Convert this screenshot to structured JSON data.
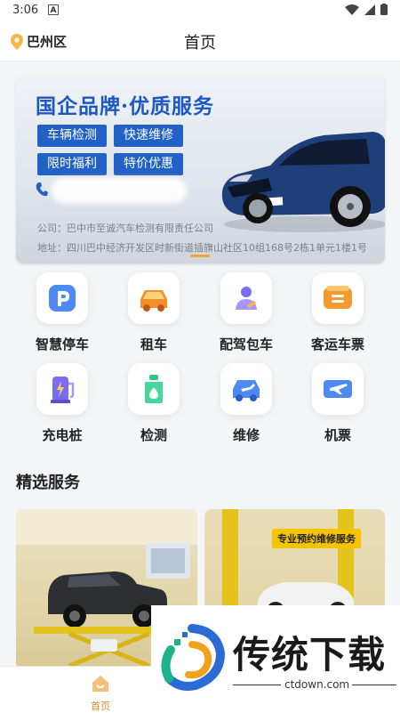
{
  "status": {
    "time": "3:06",
    "notif": "A"
  },
  "header": {
    "location": "巴州区",
    "title": "首页"
  },
  "banner": {
    "title": "国企品牌·优质服务",
    "tags": [
      "车辆检测",
      "快速维修",
      "限时福利",
      "特价优惠"
    ],
    "company": "公司：巴中市至诚汽车检测有限责任公司",
    "address": "地址：四川巴中经济开发区时新街道插旗山社区10组168号2栋1单元1楼1号"
  },
  "services": [
    {
      "label": "智慧停车",
      "icon": "parking-icon"
    },
    {
      "label": "租车",
      "icon": "car-rental-icon"
    },
    {
      "label": "配驾包车",
      "icon": "driver-icon"
    },
    {
      "label": "客运车票",
      "icon": "bus-ticket-icon"
    },
    {
      "label": "充电桩",
      "icon": "charging-icon"
    },
    {
      "label": "检测",
      "icon": "inspection-icon"
    },
    {
      "label": "维修",
      "icon": "repair-icon"
    },
    {
      "label": "机票",
      "icon": "flight-ticket-icon"
    }
  ],
  "section": {
    "title": "精选服务"
  },
  "cards": [
    {
      "image": "suv-on-lift"
    },
    {
      "banner_text": "专业预约维修服务"
    }
  ],
  "nav": {
    "home_label": "首页"
  },
  "watermark": {
    "text": "传统下载",
    "url": "ctdown.com"
  },
  "colors": {
    "accent": "#e58a1f",
    "banner_blue": "#1d57c4"
  }
}
